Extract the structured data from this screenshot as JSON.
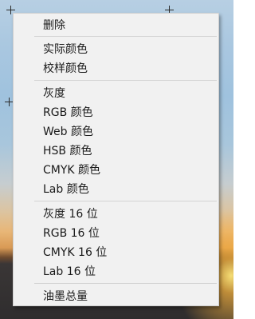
{
  "context_menu": {
    "items": [
      {
        "label": "删除"
      },
      {
        "label": "实际颜色"
      },
      {
        "label": "校样颜色"
      },
      {
        "label": "灰度"
      },
      {
        "label": "RGB 颜色"
      },
      {
        "label": "Web 颜色"
      },
      {
        "label": "HSB 颜色"
      },
      {
        "label": "CMYK 颜色"
      },
      {
        "label": "Lab 颜色"
      },
      {
        "label": "灰度 16 位"
      },
      {
        "label": "RGB 16 位"
      },
      {
        "label": "CMYK 16 位"
      },
      {
        "label": "Lab 16 位"
      },
      {
        "label": "油墨总量"
      }
    ]
  }
}
